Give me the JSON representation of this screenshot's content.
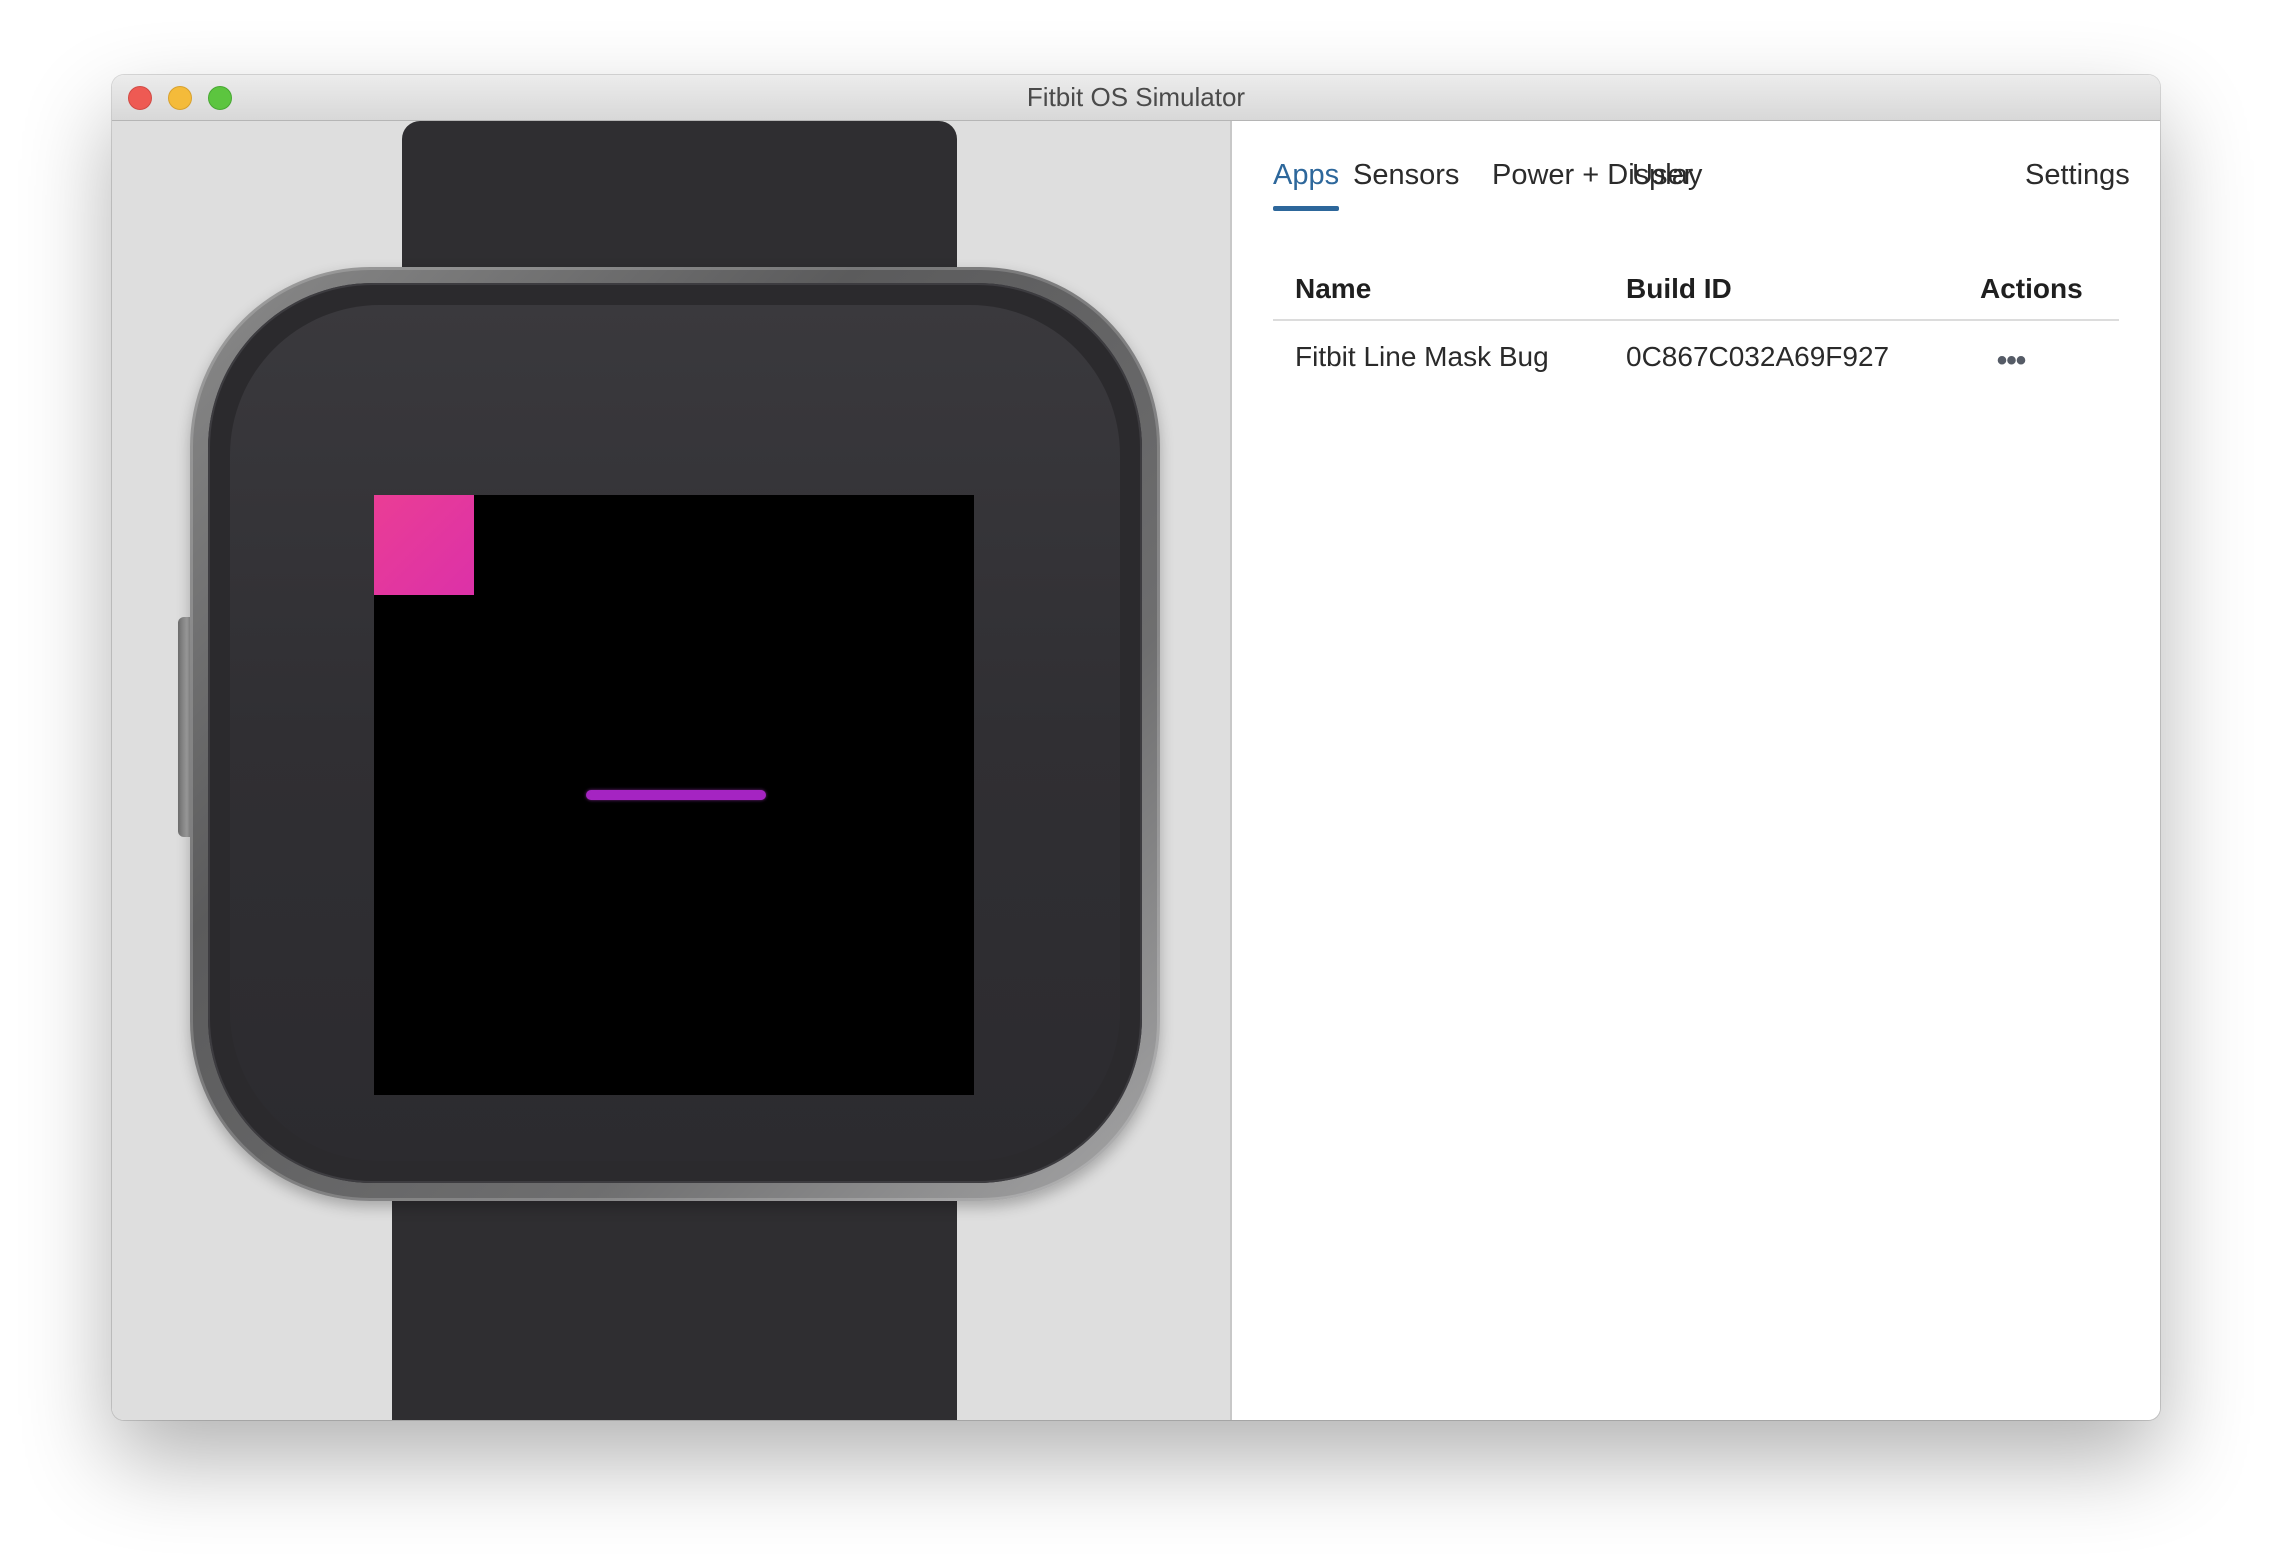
{
  "window": {
    "title": "Fitbit OS Simulator"
  },
  "tabs": [
    {
      "label": "Apps",
      "active": true
    },
    {
      "label": "Sensors",
      "active": false
    },
    {
      "label": "Power + Display",
      "active": false
    },
    {
      "label": "User",
      "active": false
    }
  ],
  "settings_label": "Settings",
  "apps_table": {
    "columns": [
      "Name",
      "Build ID",
      "Actions"
    ],
    "rows": [
      {
        "name": "Fitbit Line Mask Bug",
        "build_id": "0C867C032A69F927",
        "actions_icon": "more-horizontal-icon"
      }
    ]
  },
  "colors": {
    "accent": "#2d679b",
    "square": "#e43aa0",
    "line": "#a524c2",
    "screen": "#000000"
  }
}
